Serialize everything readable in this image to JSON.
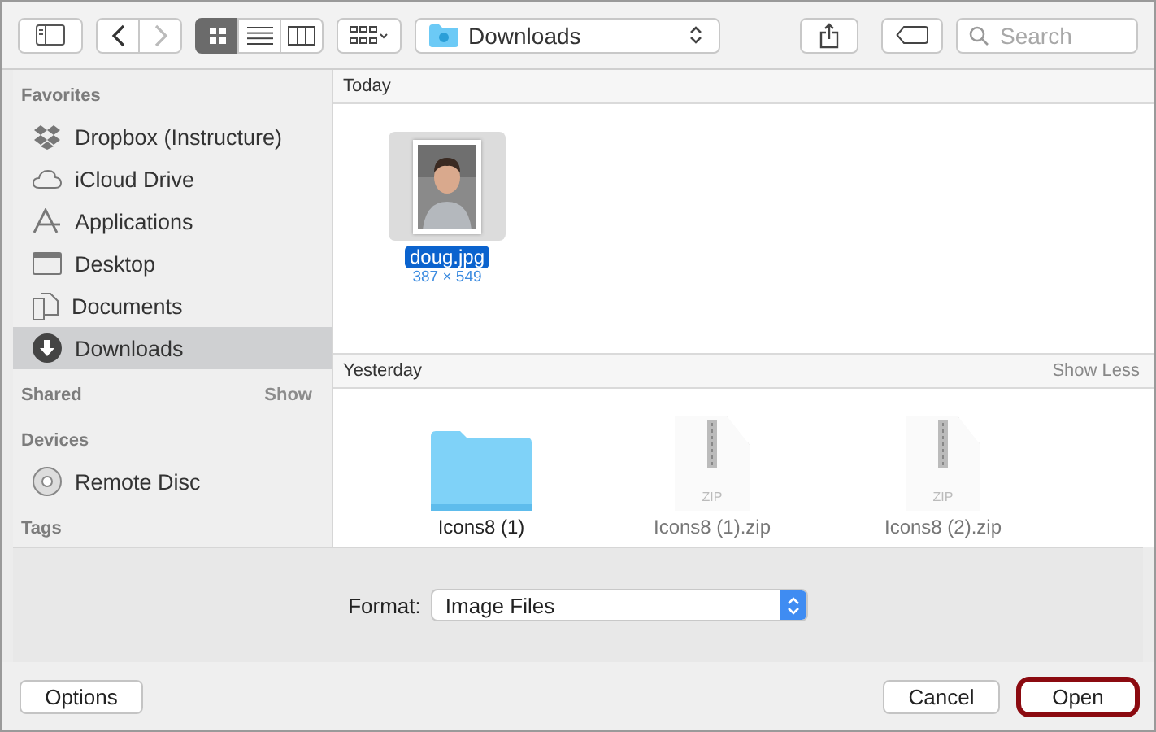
{
  "toolbar": {
    "view_modes": [
      {
        "kind": "icons",
        "selected": true
      },
      {
        "kind": "list",
        "selected": false
      },
      {
        "kind": "columns",
        "selected": false
      }
    ],
    "location": "Downloads",
    "search": {
      "placeholder": "Search"
    }
  },
  "sidebar": {
    "sections": [
      {
        "title": "Favorites",
        "items": [
          {
            "label": "Dropbox (Instructure)",
            "kind": "dropbox",
            "selected": false
          },
          {
            "label": "iCloud Drive",
            "kind": "cloud",
            "selected": false
          },
          {
            "label": "Applications",
            "kind": "apps",
            "selected": false
          },
          {
            "label": "Desktop",
            "kind": "desktop",
            "selected": false
          },
          {
            "label": "Documents",
            "kind": "documents",
            "selected": false
          },
          {
            "label": "Downloads",
            "kind": "downloads",
            "selected": true
          }
        ]
      },
      {
        "title": "Shared",
        "action": "Show"
      },
      {
        "title": "Devices",
        "items": [
          {
            "label": "Remote Disc",
            "kind": "disc",
            "selected": false
          }
        ]
      },
      {
        "title": "Tags"
      }
    ]
  },
  "groups": [
    {
      "title": "Today",
      "files": [
        {
          "name": "doug.jpg",
          "detail": "387 × 549",
          "selected": true
        }
      ]
    },
    {
      "title": "Yesterday",
      "action": "Show Less",
      "files": [
        {
          "name": "Icons8 (1)",
          "kind": "folder",
          "selected": false
        },
        {
          "name": "Icons8 (1).zip",
          "kind": "zip",
          "badge": "ZIP",
          "selected": false
        },
        {
          "name": "Icons8 (2).zip",
          "kind": "zip",
          "badge": "ZIP",
          "selected": false
        }
      ]
    }
  ],
  "format": {
    "label": "Format:",
    "value": "Image Files"
  },
  "buttons": {
    "options": "Options",
    "cancel": "Cancel",
    "open": {
      "label": "Open",
      "highlighted": true
    }
  }
}
